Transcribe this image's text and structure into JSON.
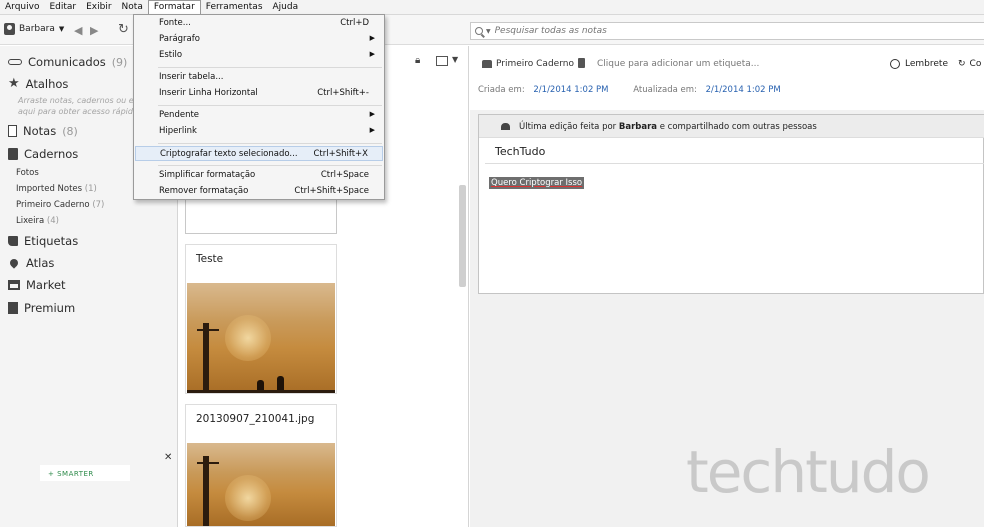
{
  "menubar": [
    "Arquivo",
    "Editar",
    "Exibir",
    "Nota",
    "Formatar",
    "Ferramentas",
    "Ajuda"
  ],
  "toolbar": {
    "user": "Barbara",
    "search_placeholder": "Pesquisar todas as notas"
  },
  "format_menu": {
    "items": [
      {
        "label": "Fonte...",
        "shortcut": "Ctrl+D",
        "arrow": ""
      },
      {
        "label": "Parágrafo",
        "shortcut": "",
        "arrow": "▶"
      },
      {
        "label": "Estilo",
        "shortcut": "",
        "arrow": "▶"
      },
      {
        "label": "Inserir tabela...",
        "shortcut": "",
        "arrow": ""
      },
      {
        "label": "Inserir Linha Horizontal",
        "shortcut": "Ctrl+Shift+-",
        "arrow": ""
      },
      {
        "label": "Pendente",
        "shortcut": "",
        "arrow": "▶"
      },
      {
        "label": "Hiperlink",
        "shortcut": "",
        "arrow": "▶"
      },
      {
        "label": "Criptografar texto selecionado...",
        "shortcut": "Ctrl+Shift+X",
        "arrow": ""
      },
      {
        "label": "Simplificar formatação",
        "shortcut": "Ctrl+Space",
        "arrow": ""
      },
      {
        "label": "Remover formatação",
        "shortcut": "Ctrl+Shift+Space",
        "arrow": ""
      }
    ]
  },
  "sidebar": {
    "comunicados": {
      "label": "Comunicados",
      "count": "(9)"
    },
    "atalhos": {
      "label": "Atalhos",
      "hint1": "Arraste notas, cadernos ou etiq",
      "hint2": "aqui para obter acesso rápido"
    },
    "notas": {
      "label": "Notas",
      "count": "(8)"
    },
    "cadernos": {
      "label": "Cadernos"
    },
    "notebooks": [
      {
        "label": "Fotos",
        "count": ""
      },
      {
        "label": "Imported Notes",
        "count": "(1)"
      },
      {
        "label": "Primeiro Caderno",
        "count": "(7)"
      },
      {
        "label": "Lixeira",
        "count": "(4)"
      }
    ],
    "etiquetas": "Etiquetas",
    "atlas": "Atlas",
    "market": "Market",
    "premium": "Premium",
    "ad_text": "+ SMARTER"
  },
  "notelist": {
    "cards": [
      {
        "title": "Teste"
      },
      {
        "title": "20130907_210041.jpg"
      }
    ]
  },
  "note": {
    "notebook": "Primeiro Caderno",
    "tag_hint": "Clique para adicionar um etiqueta...",
    "reminder": "Lembrete",
    "share": "Co",
    "created_label": "Criada em:",
    "created": "2/1/2014 1:02 PM",
    "updated_label": "Atualizada em:",
    "updated": "2/1/2014 1:02 PM",
    "banner_pre": "Última edição feita por ",
    "banner_user": "Barbara",
    "banner_post": " e compartilhado com outras pessoas",
    "title": "TechTudo",
    "selected_text": "Quero Criptograr Isso"
  },
  "watermark": "techtudo"
}
